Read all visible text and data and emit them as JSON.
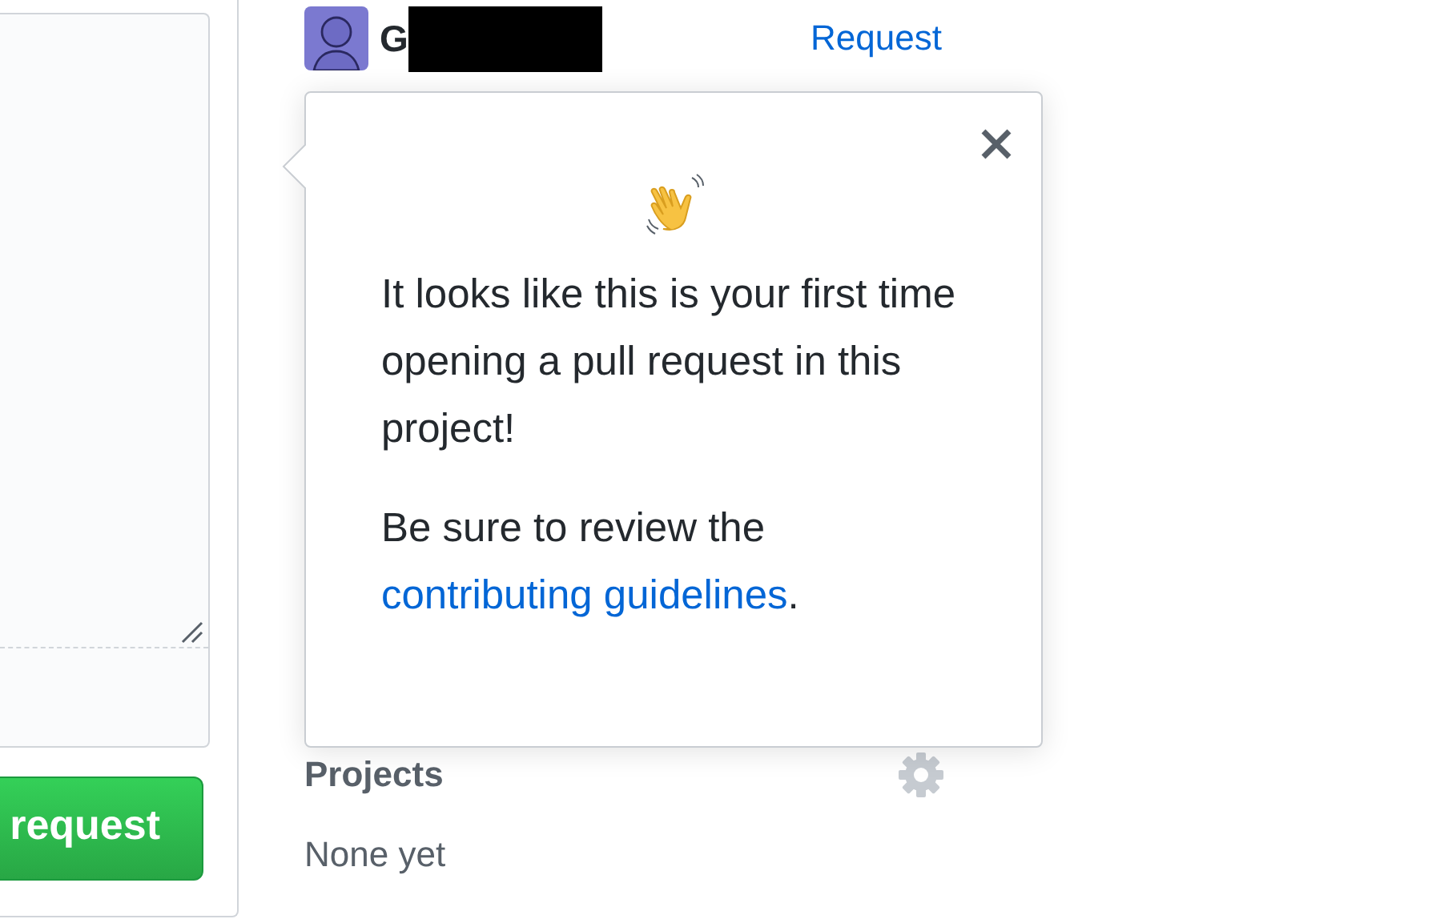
{
  "main": {
    "submit_button": {
      "label": "request"
    }
  },
  "reviewer": {
    "name": "G",
    "action_link": "Request"
  },
  "popover": {
    "intro": "It looks like this is your first time opening a pull request in this project!",
    "review": {
      "text": "Be sure to review the ",
      "link": "contributing guidelines",
      "after": "."
    }
  },
  "projects": {
    "title": "Projects",
    "value": "None yet"
  }
}
